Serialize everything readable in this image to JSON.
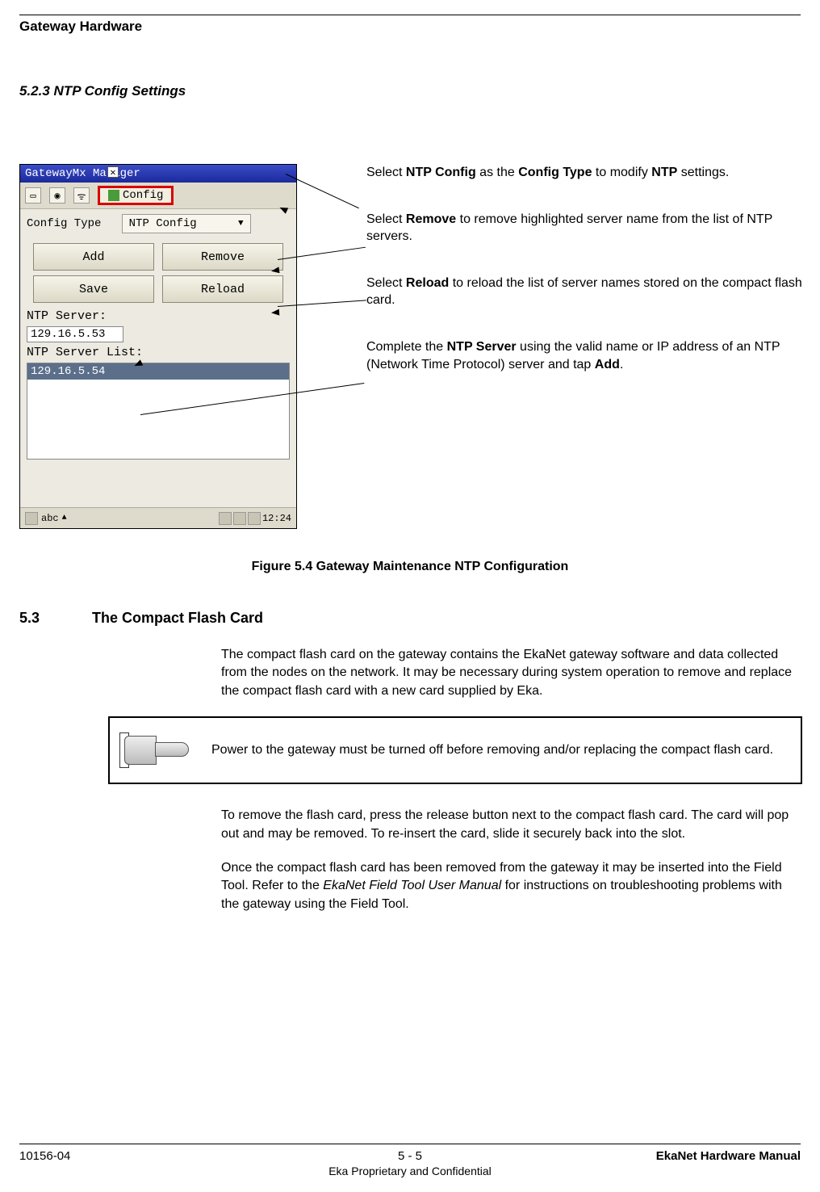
{
  "header": {
    "running": "Gateway Hardware"
  },
  "section523": {
    "num_title": "5.2.3     NTP Config Settings"
  },
  "screenshot": {
    "title": "GatewayMx Manager",
    "config_tab": "Config",
    "config_type_label": "Config Type",
    "config_type_value": "NTP Config",
    "buttons": {
      "add": "Add",
      "remove": "Remove",
      "save": "Save",
      "reload": "Reload"
    },
    "ntp_server_label": "NTP Server:",
    "ntp_server_value": "129.16.5.53",
    "ntp_list_label": "NTP Server List:",
    "ntp_list_items": [
      "129.16.5.54"
    ],
    "statusbar": {
      "mode": "abc",
      "time": "12:24"
    }
  },
  "annotations": {
    "a1_pre": "Select ",
    "a1_b1": "NTP Config",
    "a1_mid": " as the ",
    "a1_b2": "Config Type",
    "a1_post": " to modify ",
    "a1_b3": "NTP",
    "a1_end": " settings.",
    "a2_pre": "Select ",
    "a2_b1": "Remove",
    "a2_post": " to remove highlighted server name from the list of NTP servers.",
    "a3_pre": "Select ",
    "a3_b1": "Reload",
    "a3_post": " to reload the list of server names stored on the compact flash card.",
    "a4_pre": "Complete the ",
    "a4_b1": "NTP Server",
    "a4_mid": " using the valid name or IP address of an NTP (Network Time Protocol) server and tap ",
    "a4_b2": "Add",
    "a4_end": "."
  },
  "figure_caption": "Figure 5.4  Gateway Maintenance NTP Configuration",
  "section53": {
    "num": "5.3",
    "title": "The Compact Flash Card",
    "p1": "The compact flash card on the gateway contains the EkaNet gateway software and data collected from the nodes on the network. It may be necessary during system operation to remove and replace the compact flash card with a new card supplied by Eka.",
    "note": "Power to the gateway must be turned off before removing and/or replacing the compact flash card.",
    "p2": "To remove the flash card, press the release button next to the compact flash card. The card will pop out and may be removed. To re-insert the card, slide it securely back into the slot.",
    "p3_pre": "Once the compact flash card has been removed from the gateway it may be inserted into the Field Tool. Refer to the ",
    "p3_em": "EkaNet Field Tool User Manual",
    "p3_post": " for instructions on troubleshooting problems with the gateway using the Field Tool."
  },
  "footer": {
    "left": "10156-04",
    "center": "5 - 5",
    "right": "EkaNet Hardware Manual",
    "sub": "Eka Proprietary and Confidential"
  }
}
